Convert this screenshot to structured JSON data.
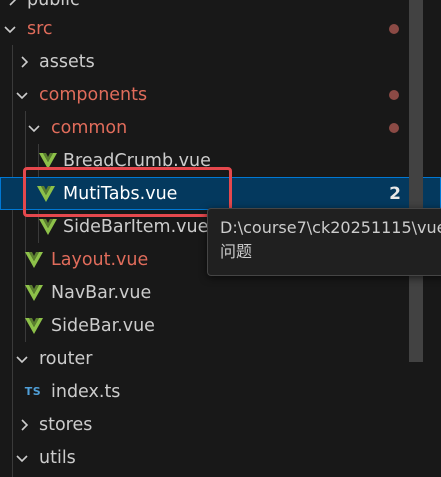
{
  "tree": {
    "items": [
      {
        "label": "public",
        "kind": "folder",
        "expanded": false,
        "modified": false
      },
      {
        "label": "src",
        "kind": "folder",
        "expanded": true,
        "modified": true
      },
      {
        "label": "assets",
        "kind": "folder",
        "expanded": false,
        "modified": false
      },
      {
        "label": "components",
        "kind": "folder",
        "expanded": true,
        "modified": true
      },
      {
        "label": "common",
        "kind": "folder",
        "expanded": true,
        "modified": true
      },
      {
        "label": "BreadCrumb.vue",
        "kind": "vue",
        "modified": false
      },
      {
        "label": "MutiTabs.vue",
        "kind": "vue",
        "modified": false,
        "selected": true,
        "badge": "2"
      },
      {
        "label": "SideBarItem.vue",
        "kind": "vue",
        "modified": false
      },
      {
        "label": "Layout.vue",
        "kind": "vue",
        "modified": true
      },
      {
        "label": "NavBar.vue",
        "kind": "vue",
        "modified": false
      },
      {
        "label": "SideBar.vue",
        "kind": "vue",
        "modified": false
      },
      {
        "label": "router",
        "kind": "folder",
        "expanded": true,
        "modified": false
      },
      {
        "label": "index.ts",
        "kind": "ts",
        "modified": false
      },
      {
        "label": "stores",
        "kind": "folder",
        "expanded": false,
        "modified": false
      },
      {
        "label": "utils",
        "kind": "folder",
        "expanded": true,
        "modified": false
      }
    ]
  },
  "tooltip": {
    "path": "D:\\course7\\ck20251115\\vue",
    "status": "问题"
  },
  "icons": {
    "ts_label": "TS"
  },
  "colors": {
    "modified": "#e06c5b",
    "vue_green": "#8dc149",
    "selected_bg": "#04395e",
    "highlight": "#e5484d",
    "ts_blue": "#4f9fd8"
  }
}
